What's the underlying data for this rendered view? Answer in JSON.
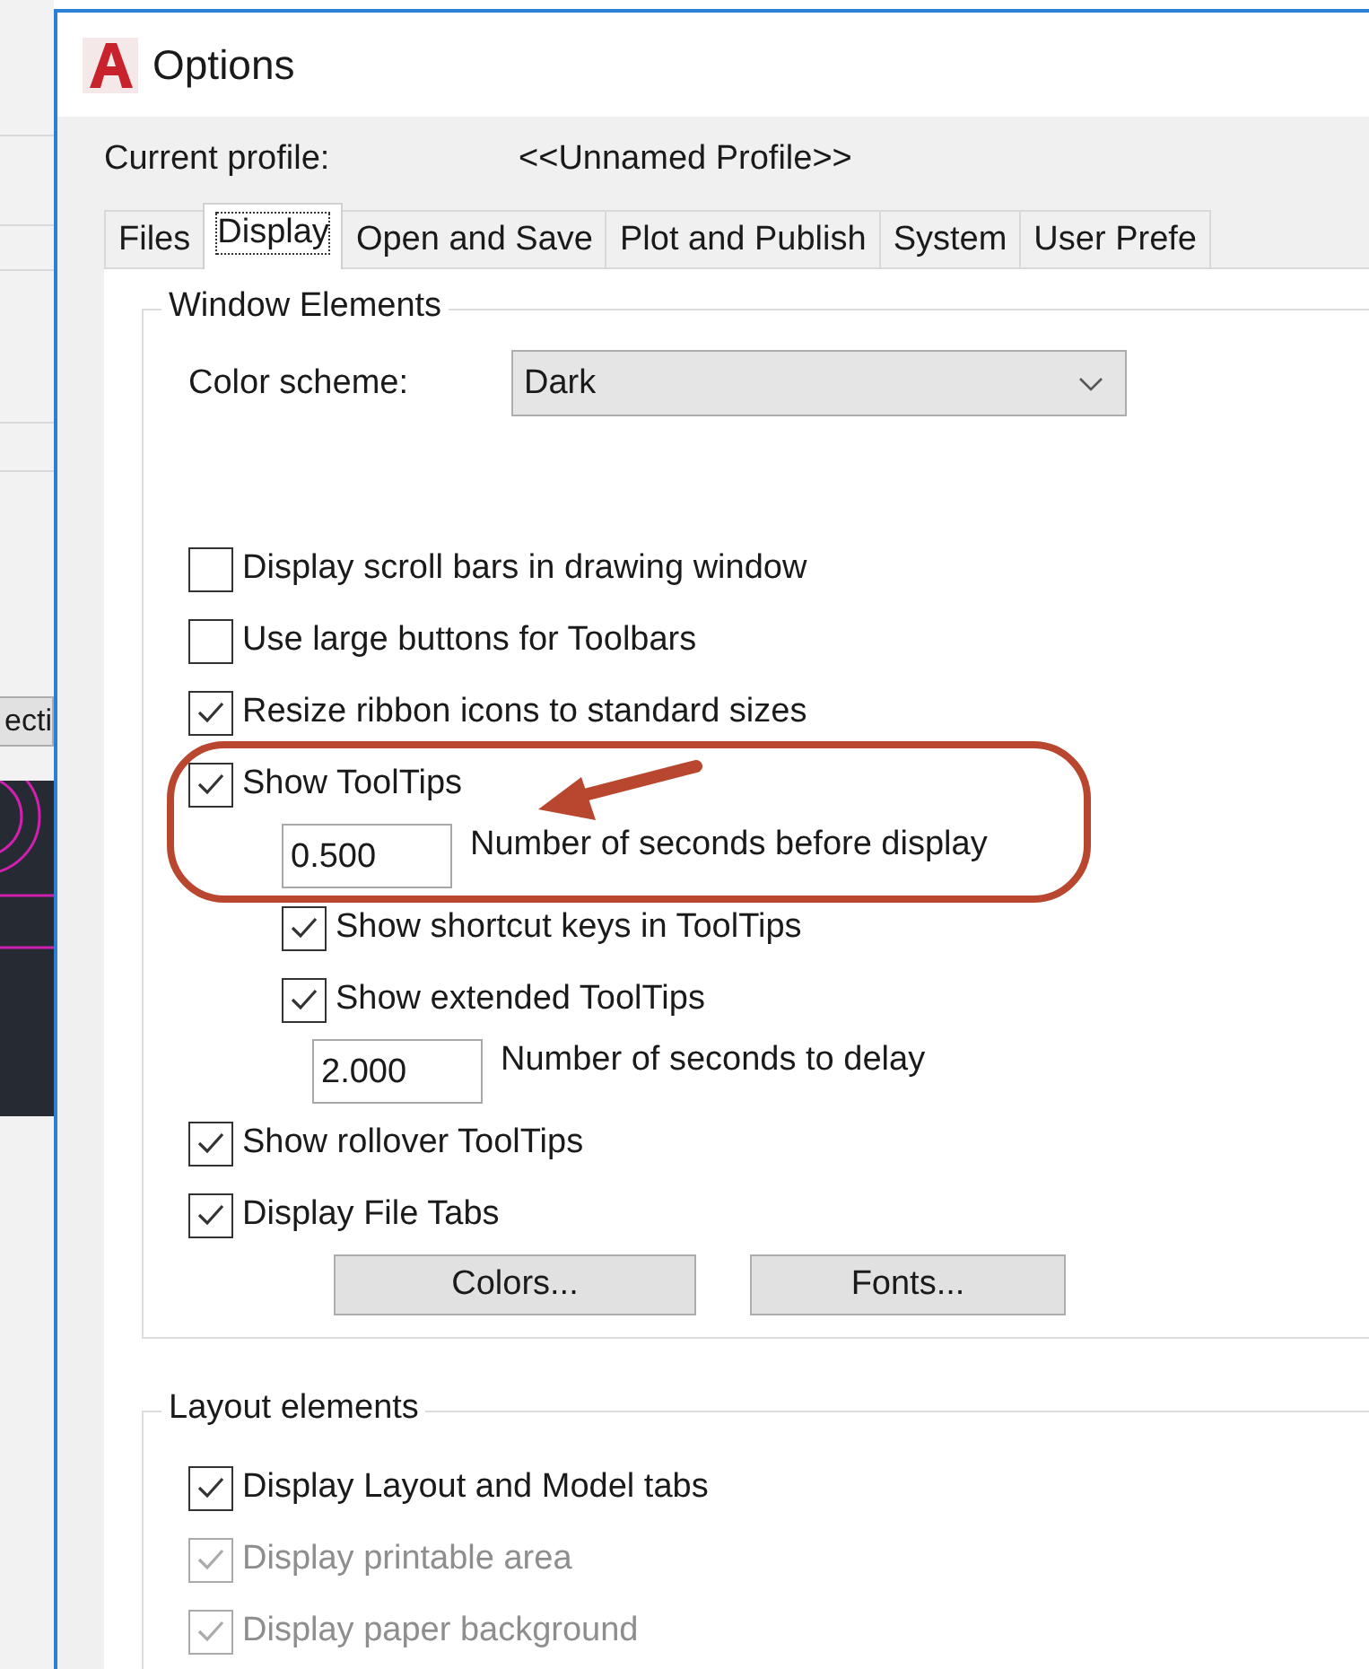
{
  "background_app": {
    "button": "ecti"
  },
  "window": {
    "title": "Options"
  },
  "profile": {
    "label": "Current profile:",
    "value": "<<Unnamed Profile>>"
  },
  "tabs": [
    {
      "label": "Files",
      "selected": false
    },
    {
      "label": "Display",
      "selected": true
    },
    {
      "label": "Open and Save",
      "selected": false
    },
    {
      "label": "Plot and Publish",
      "selected": false
    },
    {
      "label": "System",
      "selected": false
    },
    {
      "label": "User Prefe",
      "selected": false
    }
  ],
  "window_elements": {
    "title": "Window Elements",
    "color_scheme": {
      "label": "Color scheme:",
      "value": "Dark"
    },
    "items": [
      {
        "kind": "checkbox",
        "label": "Display scroll bars in drawing window",
        "checked": false,
        "disabled": false
      },
      {
        "kind": "checkbox",
        "label": "Use large buttons for Toolbars",
        "checked": false,
        "disabled": false
      },
      {
        "kind": "checkbox",
        "label": "Resize ribbon icons to standard sizes",
        "checked": true,
        "disabled": false
      },
      {
        "kind": "checkbox",
        "label": "Show ToolTips",
        "checked": true,
        "disabled": false,
        "children": [
          {
            "kind": "number",
            "value": "0.500",
            "label": "Number of seconds before display"
          },
          {
            "kind": "checkbox",
            "label": "Show shortcut keys in ToolTips",
            "checked": true,
            "disabled": false
          },
          {
            "kind": "checkbox",
            "label": "Show extended ToolTips",
            "checked": true,
            "disabled": false,
            "children": [
              {
                "kind": "number",
                "value": "2.000",
                "label": "Number of seconds to delay"
              }
            ]
          }
        ]
      },
      {
        "kind": "checkbox",
        "label": "Show rollover ToolTips",
        "checked": true,
        "disabled": false
      },
      {
        "kind": "checkbox",
        "label": "Display File Tabs",
        "checked": true,
        "disabled": false
      }
    ],
    "buttons": [
      "Colors...",
      "Fonts..."
    ]
  },
  "layout_elements": {
    "title": "Layout elements",
    "items": [
      {
        "kind": "checkbox",
        "label": "Display Layout and Model tabs",
        "checked": true,
        "disabled": false
      },
      {
        "kind": "checkbox",
        "label": "Display printable area",
        "checked": true,
        "disabled": true
      },
      {
        "kind": "checkbox",
        "label": "Display paper background",
        "checked": true,
        "disabled": true
      }
    ]
  }
}
